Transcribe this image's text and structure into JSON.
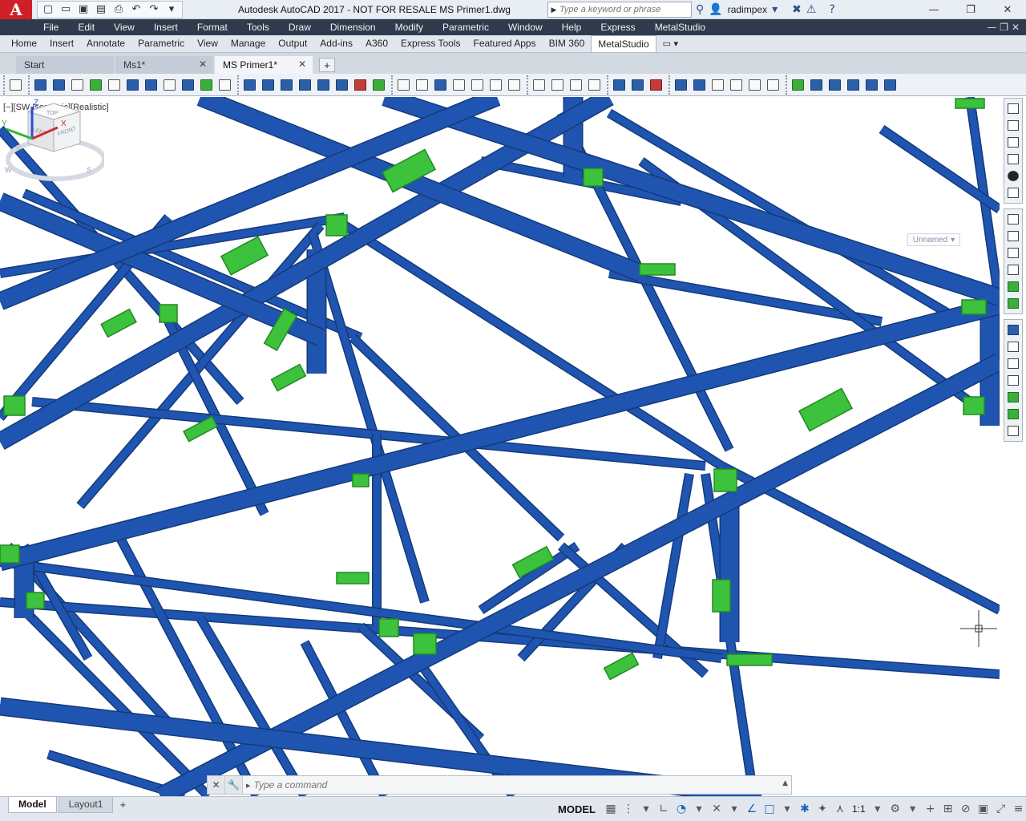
{
  "window": {
    "title": "Autodesk AutoCAD 2017 - NOT FOR RESALE    MS Primer1.dwg",
    "app_logo": "A",
    "search_placeholder": "Type a keyword or phrase",
    "user": "radimpex",
    "controls": {
      "minimize": "—",
      "restore": "❐",
      "close": "✕"
    }
  },
  "quick_access": [
    "new-icon",
    "open-icon",
    "save-icon",
    "save-as-icon",
    "print-icon",
    "undo-icon",
    "redo-icon"
  ],
  "menu": [
    "File",
    "Edit",
    "View",
    "Insert",
    "Format",
    "Tools",
    "Draw",
    "Dimension",
    "Modify",
    "Parametric",
    "Window",
    "Help",
    "Express",
    "MetalStudio"
  ],
  "ribbon_tabs": [
    {
      "label": "Home",
      "active": false
    },
    {
      "label": "Insert",
      "active": false
    },
    {
      "label": "Annotate",
      "active": false
    },
    {
      "label": "Parametric",
      "active": false
    },
    {
      "label": "View",
      "active": false
    },
    {
      "label": "Manage",
      "active": false
    },
    {
      "label": "Output",
      "active": false
    },
    {
      "label": "Add-ins",
      "active": false
    },
    {
      "label": "A360",
      "active": false
    },
    {
      "label": "Express Tools",
      "active": false
    },
    {
      "label": "Featured Apps",
      "active": false
    },
    {
      "label": "BIM 360",
      "active": false
    },
    {
      "label": "MetalStudio",
      "active": true
    }
  ],
  "doc_tabs": [
    {
      "label": "Start",
      "active": false,
      "closable": false
    },
    {
      "label": "Ms1*",
      "active": false,
      "closable": true
    },
    {
      "label": "MS Primer1*",
      "active": true,
      "closable": true
    }
  ],
  "viewport": {
    "label": "[−][SW Isometric][Realistic]",
    "viewcube": {
      "top": "TOP",
      "left": "LEFT",
      "front": "FRONT",
      "compass_w": "W",
      "compass_s": "S",
      "compass_n": "N"
    },
    "ucs_name": "Unnamed",
    "axes": {
      "x": "X",
      "y": "Y",
      "z": "Z"
    },
    "colors": {
      "beam": "#1f55b0",
      "beam_dark": "#143a7a",
      "plate": "#3cc23c",
      "plate_dark": "#238a23"
    }
  },
  "command_line": {
    "placeholder": "Type a command",
    "close": "✕",
    "settings": "🔧",
    "prompt": "▸"
  },
  "status": {
    "layout_tabs": [
      {
        "label": "Model",
        "active": true
      },
      {
        "label": "Layout1",
        "active": false
      }
    ],
    "model_label": "MODEL",
    "scale": "1:1"
  }
}
